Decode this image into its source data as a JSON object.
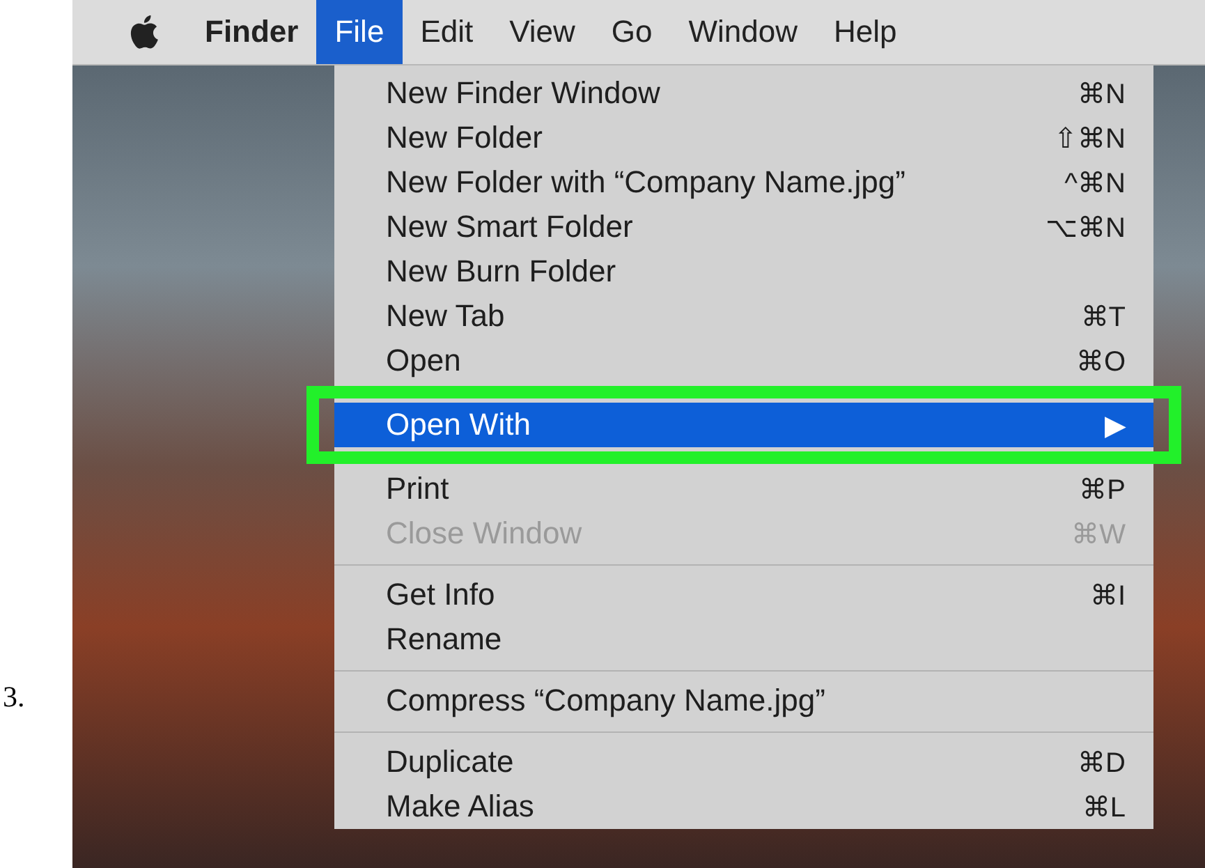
{
  "step_number": "3.",
  "menu_bar": [
    {
      "label": "Finder",
      "kind": "app",
      "selected": false
    },
    {
      "label": "File",
      "kind": "menu",
      "selected": true
    },
    {
      "label": "Edit",
      "kind": "menu",
      "selected": false
    },
    {
      "label": "View",
      "kind": "menu",
      "selected": false
    },
    {
      "label": "Go",
      "kind": "menu",
      "selected": false
    },
    {
      "label": "Window",
      "kind": "menu",
      "selected": false
    },
    {
      "label": "Help",
      "kind": "menu",
      "selected": false
    }
  ],
  "file_menu": [
    {
      "kind": "item",
      "label": "New Finder Window",
      "shortcut": "⌘N",
      "disabled": false,
      "selected": false
    },
    {
      "kind": "item",
      "label": "New Folder",
      "shortcut": "⇧⌘N",
      "disabled": false,
      "selected": false
    },
    {
      "kind": "item",
      "label": "New Folder with “Company Name.jpg”",
      "shortcut": "^⌘N",
      "disabled": false,
      "selected": false
    },
    {
      "kind": "item",
      "label": "New Smart Folder",
      "shortcut": "⌥⌘N",
      "disabled": false,
      "selected": false
    },
    {
      "kind": "item",
      "label": "New Burn Folder",
      "disabled": false,
      "selected": false
    },
    {
      "kind": "item",
      "label": "New Tab",
      "shortcut": "⌘T",
      "disabled": false,
      "selected": false
    },
    {
      "kind": "item",
      "label": "Open",
      "shortcut": "⌘O",
      "disabled": false,
      "selected": false
    },
    {
      "kind": "item",
      "label": "Open With",
      "shortcut": "▶",
      "disabled": false,
      "selected": true,
      "outlined": true
    },
    {
      "kind": "item",
      "label": "Print",
      "shortcut": "⌘P",
      "disabled": false,
      "selected": false
    },
    {
      "kind": "item",
      "label": "Close Window",
      "shortcut": "⌘W",
      "disabled": true,
      "selected": false
    },
    {
      "kind": "separator"
    },
    {
      "kind": "item",
      "label": "Get Info",
      "shortcut": "⌘I",
      "disabled": false,
      "selected": false
    },
    {
      "kind": "item",
      "label": "Rename",
      "disabled": false,
      "selected": false
    },
    {
      "kind": "separator"
    },
    {
      "kind": "item",
      "label": "Compress “Company Name.jpg”",
      "disabled": false,
      "selected": false
    },
    {
      "kind": "separator"
    },
    {
      "kind": "item",
      "label": "Duplicate",
      "shortcut": "⌘D",
      "disabled": false,
      "selected": false
    },
    {
      "kind": "item",
      "label": "Make Alias",
      "shortcut": "⌘L",
      "disabled": false,
      "selected": false
    }
  ]
}
